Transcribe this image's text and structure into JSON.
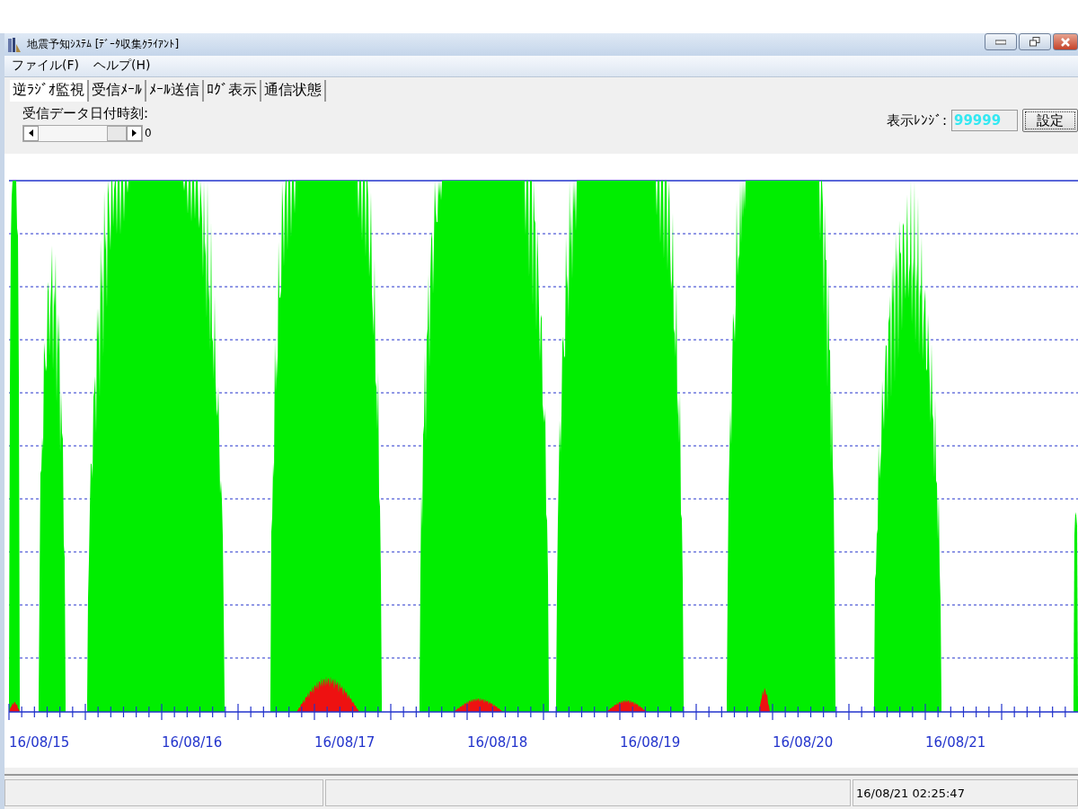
{
  "window": {
    "title": "地震予知ｼｽﾃﾑ [ﾃﾞｰﾀ収集ｸﾗｲｱﾝﾄ]"
  },
  "menu": [
    {
      "label": "ファイル(F)"
    },
    {
      "label": "ヘルプ(H)"
    }
  ],
  "tabs": [
    {
      "label": "逆ﾗｼﾞｵ監視",
      "selected": true
    },
    {
      "label": "受信ﾒｰﾙ",
      "selected": false
    },
    {
      "label": "ﾒｰﾙ送信",
      "selected": false
    },
    {
      "label": "ﾛｸﾞ表示",
      "selected": false
    },
    {
      "label": "通信状態",
      "selected": false
    }
  ],
  "date_scroll": {
    "label": "受信データ日付時刻:",
    "reading": "0"
  },
  "range": {
    "label": "表示ﾚﾝｼﾞ:",
    "value": "99999",
    "button": "設定"
  },
  "chart": {
    "x_labels": [
      "16/08/15",
      "16/08/16",
      "16/08/17",
      "16/08/18",
      "16/08/19",
      "16/08/20",
      "16/08/21"
    ]
  },
  "status_bar": {
    "time": "16/08/21 02:25:47"
  }
}
